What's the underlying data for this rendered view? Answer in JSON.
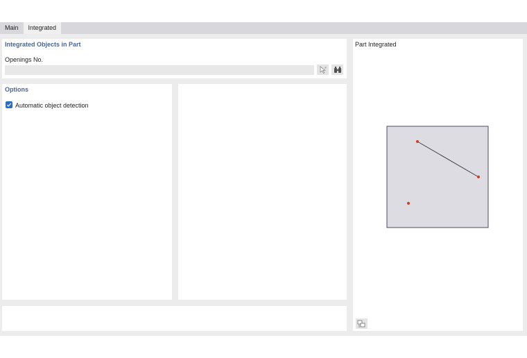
{
  "tabs": [
    {
      "label": "Main",
      "active": false
    },
    {
      "label": "Integrated",
      "active": true
    }
  ],
  "integrated_objects": {
    "title": "Integrated Objects in Part",
    "openings_label": "Openings No.",
    "openings_value": ""
  },
  "options": {
    "title": "Options",
    "automatic_detection_label": "Automatic object detection",
    "automatic_detection_checked": true
  },
  "preview": {
    "title": "Part Integrated",
    "fill_color": "#dcdce2",
    "border_color": "#4a4a6a",
    "point_color": "#d23c1e",
    "line_color": "#404050"
  },
  "icons": {
    "select_icon": "pick-select-icon",
    "binoculars_icon": "binoculars-icon",
    "preview_settings_icon": "preview-settings-icon",
    "checkmark_icon": "checkmark-icon"
  }
}
